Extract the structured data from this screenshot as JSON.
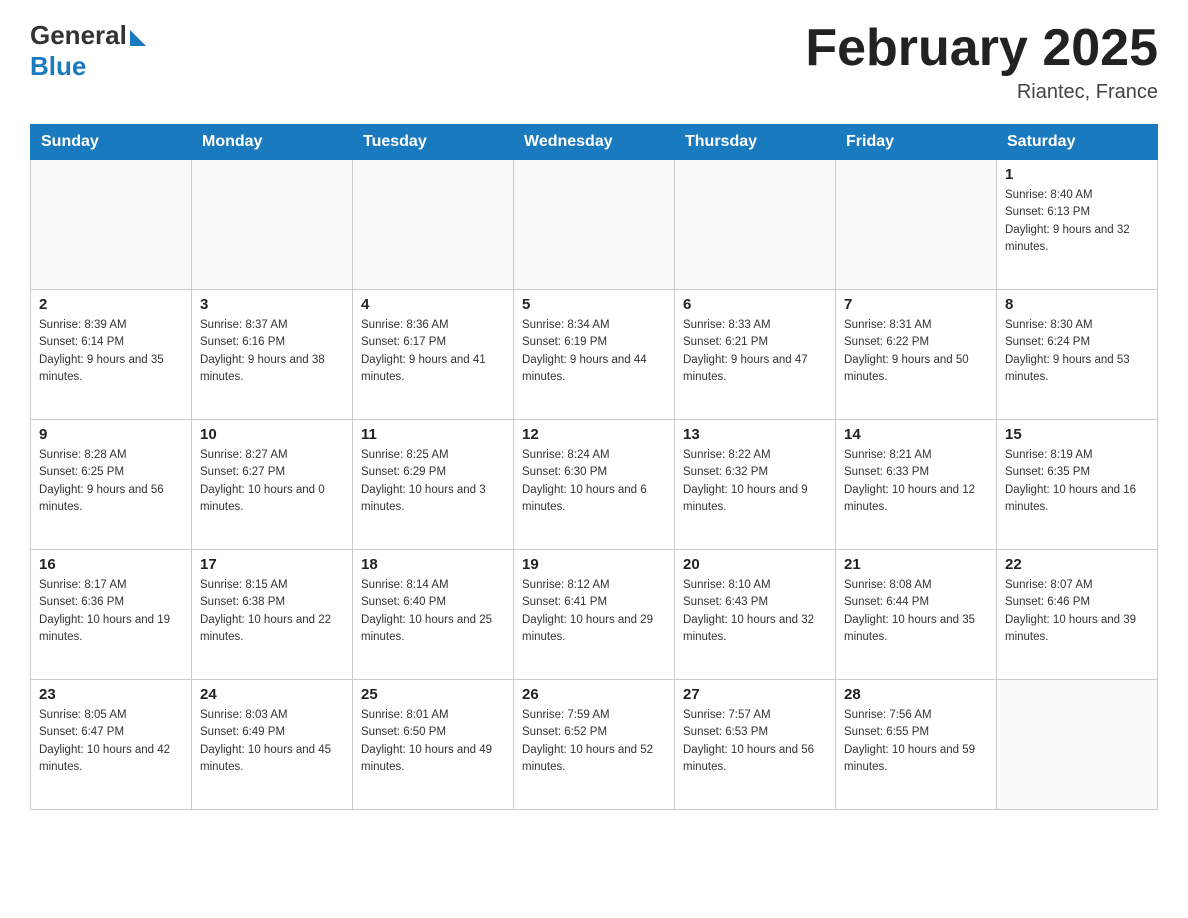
{
  "logo": {
    "general": "General",
    "blue": "Blue"
  },
  "title": "February 2025",
  "location": "Riantec, France",
  "days_of_week": [
    "Sunday",
    "Monday",
    "Tuesday",
    "Wednesday",
    "Thursday",
    "Friday",
    "Saturday"
  ],
  "weeks": [
    [
      {
        "day": "",
        "info": ""
      },
      {
        "day": "",
        "info": ""
      },
      {
        "day": "",
        "info": ""
      },
      {
        "day": "",
        "info": ""
      },
      {
        "day": "",
        "info": ""
      },
      {
        "day": "",
        "info": ""
      },
      {
        "day": "1",
        "info": "Sunrise: 8:40 AM\nSunset: 6:13 PM\nDaylight: 9 hours and 32 minutes."
      }
    ],
    [
      {
        "day": "2",
        "info": "Sunrise: 8:39 AM\nSunset: 6:14 PM\nDaylight: 9 hours and 35 minutes."
      },
      {
        "day": "3",
        "info": "Sunrise: 8:37 AM\nSunset: 6:16 PM\nDaylight: 9 hours and 38 minutes."
      },
      {
        "day": "4",
        "info": "Sunrise: 8:36 AM\nSunset: 6:17 PM\nDaylight: 9 hours and 41 minutes."
      },
      {
        "day": "5",
        "info": "Sunrise: 8:34 AM\nSunset: 6:19 PM\nDaylight: 9 hours and 44 minutes."
      },
      {
        "day": "6",
        "info": "Sunrise: 8:33 AM\nSunset: 6:21 PM\nDaylight: 9 hours and 47 minutes."
      },
      {
        "day": "7",
        "info": "Sunrise: 8:31 AM\nSunset: 6:22 PM\nDaylight: 9 hours and 50 minutes."
      },
      {
        "day": "8",
        "info": "Sunrise: 8:30 AM\nSunset: 6:24 PM\nDaylight: 9 hours and 53 minutes."
      }
    ],
    [
      {
        "day": "9",
        "info": "Sunrise: 8:28 AM\nSunset: 6:25 PM\nDaylight: 9 hours and 56 minutes."
      },
      {
        "day": "10",
        "info": "Sunrise: 8:27 AM\nSunset: 6:27 PM\nDaylight: 10 hours and 0 minutes."
      },
      {
        "day": "11",
        "info": "Sunrise: 8:25 AM\nSunset: 6:29 PM\nDaylight: 10 hours and 3 minutes."
      },
      {
        "day": "12",
        "info": "Sunrise: 8:24 AM\nSunset: 6:30 PM\nDaylight: 10 hours and 6 minutes."
      },
      {
        "day": "13",
        "info": "Sunrise: 8:22 AM\nSunset: 6:32 PM\nDaylight: 10 hours and 9 minutes."
      },
      {
        "day": "14",
        "info": "Sunrise: 8:21 AM\nSunset: 6:33 PM\nDaylight: 10 hours and 12 minutes."
      },
      {
        "day": "15",
        "info": "Sunrise: 8:19 AM\nSunset: 6:35 PM\nDaylight: 10 hours and 16 minutes."
      }
    ],
    [
      {
        "day": "16",
        "info": "Sunrise: 8:17 AM\nSunset: 6:36 PM\nDaylight: 10 hours and 19 minutes."
      },
      {
        "day": "17",
        "info": "Sunrise: 8:15 AM\nSunset: 6:38 PM\nDaylight: 10 hours and 22 minutes."
      },
      {
        "day": "18",
        "info": "Sunrise: 8:14 AM\nSunset: 6:40 PM\nDaylight: 10 hours and 25 minutes."
      },
      {
        "day": "19",
        "info": "Sunrise: 8:12 AM\nSunset: 6:41 PM\nDaylight: 10 hours and 29 minutes."
      },
      {
        "day": "20",
        "info": "Sunrise: 8:10 AM\nSunset: 6:43 PM\nDaylight: 10 hours and 32 minutes."
      },
      {
        "day": "21",
        "info": "Sunrise: 8:08 AM\nSunset: 6:44 PM\nDaylight: 10 hours and 35 minutes."
      },
      {
        "day": "22",
        "info": "Sunrise: 8:07 AM\nSunset: 6:46 PM\nDaylight: 10 hours and 39 minutes."
      }
    ],
    [
      {
        "day": "23",
        "info": "Sunrise: 8:05 AM\nSunset: 6:47 PM\nDaylight: 10 hours and 42 minutes."
      },
      {
        "day": "24",
        "info": "Sunrise: 8:03 AM\nSunset: 6:49 PM\nDaylight: 10 hours and 45 minutes."
      },
      {
        "day": "25",
        "info": "Sunrise: 8:01 AM\nSunset: 6:50 PM\nDaylight: 10 hours and 49 minutes."
      },
      {
        "day": "26",
        "info": "Sunrise: 7:59 AM\nSunset: 6:52 PM\nDaylight: 10 hours and 52 minutes."
      },
      {
        "day": "27",
        "info": "Sunrise: 7:57 AM\nSunset: 6:53 PM\nDaylight: 10 hours and 56 minutes."
      },
      {
        "day": "28",
        "info": "Sunrise: 7:56 AM\nSunset: 6:55 PM\nDaylight: 10 hours and 59 minutes."
      },
      {
        "day": "",
        "info": ""
      }
    ]
  ]
}
